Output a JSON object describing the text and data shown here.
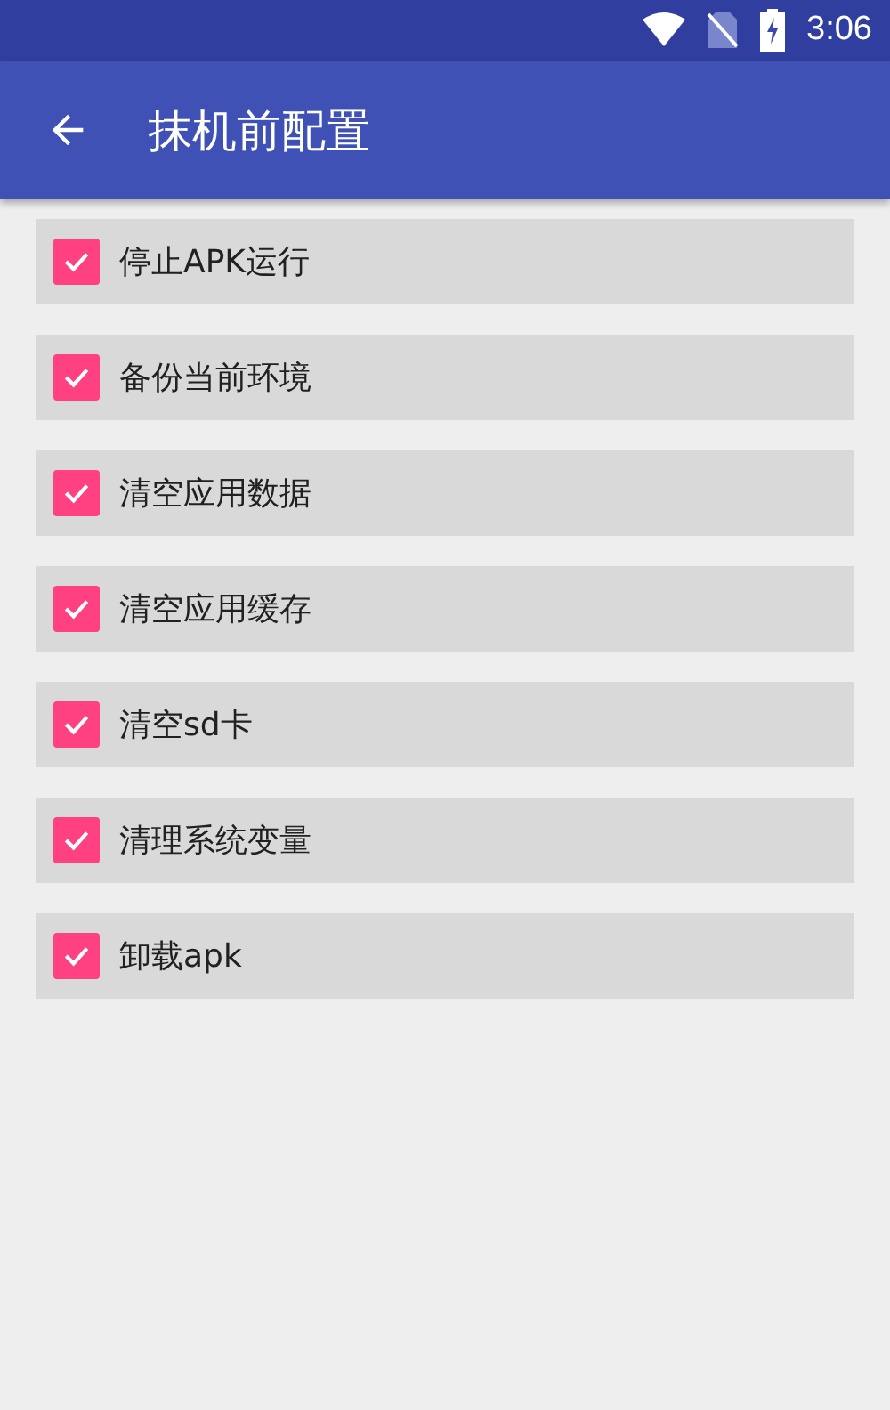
{
  "status_bar": {
    "time": "3:06"
  },
  "app_bar": {
    "title": "抹机前配置"
  },
  "options": [
    {
      "label": "停止APK运行",
      "checked": true
    },
    {
      "label": "备份当前环境",
      "checked": true
    },
    {
      "label": "清空应用数据",
      "checked": true
    },
    {
      "label": "清空应用缓存",
      "checked": true
    },
    {
      "label": "清空sd卡",
      "checked": true
    },
    {
      "label": "清理系统变量",
      "checked": true
    },
    {
      "label": "卸载apk",
      "checked": true
    }
  ]
}
